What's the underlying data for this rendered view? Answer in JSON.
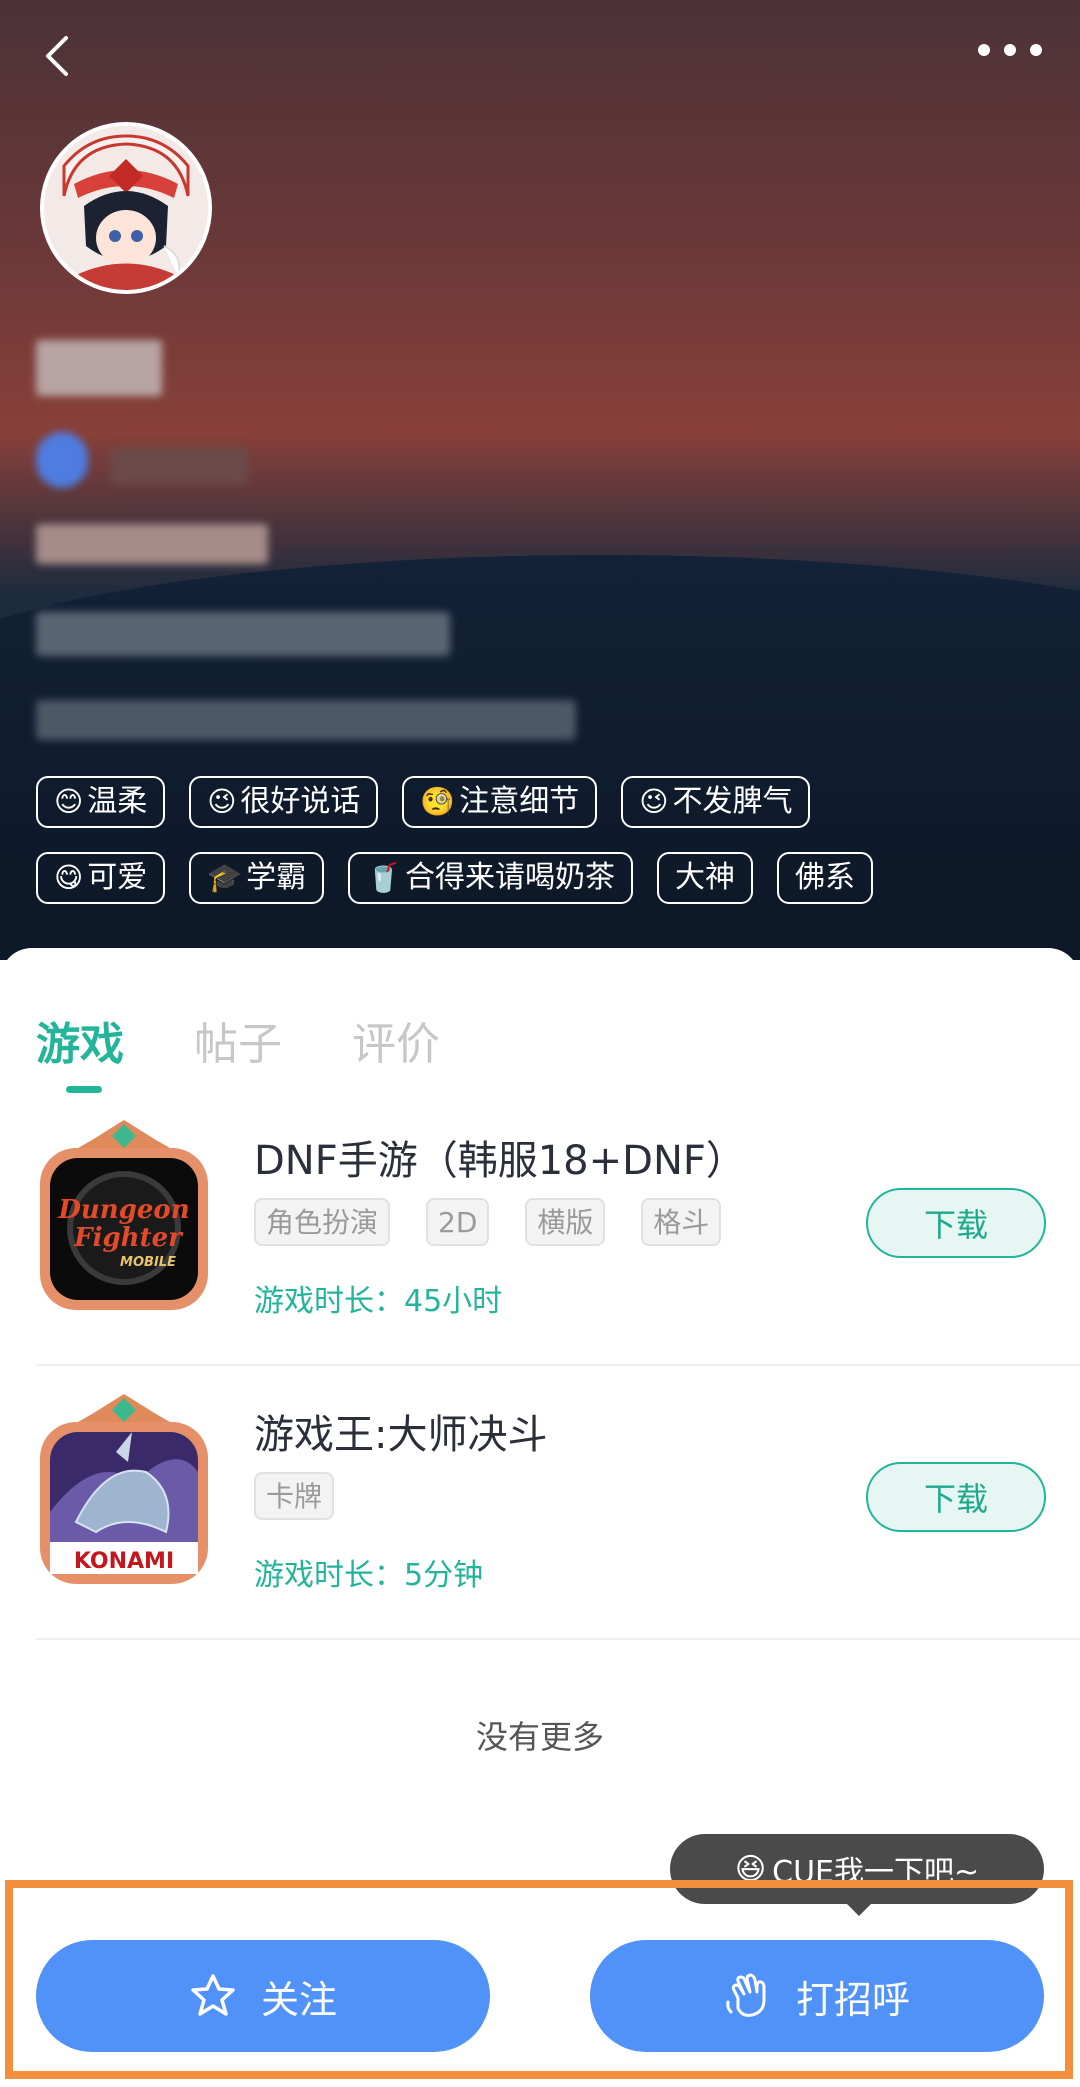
{
  "topbar": {
    "back_icon": "chevron-left-icon",
    "more_icon": "more-dots-icon"
  },
  "profile": {
    "tags_row1": [
      {
        "emoji": "😊",
        "label": "温柔"
      },
      {
        "emoji": "😉",
        "label": "很好说话"
      },
      {
        "emoji": "🧐",
        "label": "注意细节"
      },
      {
        "emoji": "😉",
        "label": "不发脾气"
      }
    ],
    "tags_row2": [
      {
        "emoji": "😋",
        "label": "可爱"
      },
      {
        "emoji": "🎓",
        "label": "学霸"
      },
      {
        "emoji": "🥤",
        "label": "合得来请喝奶茶"
      },
      {
        "emoji": "",
        "label": "大神"
      },
      {
        "emoji": "",
        "label": "佛系"
      }
    ]
  },
  "tabs": [
    {
      "label": "游戏",
      "active": true
    },
    {
      "label": "帖子",
      "active": false
    },
    {
      "label": "评价",
      "active": false
    }
  ],
  "games": [
    {
      "title": "DNF手游（韩服18+DNF）",
      "tags": [
        "角色扮演",
        "2D",
        "横版",
        "格斗"
      ],
      "playtime_label": "游戏时长：",
      "playtime": "45小时",
      "download_label": "下载",
      "icon_text_1": "Dungeon",
      "icon_text_2": "Fighter",
      "icon_text_3": "MOBILE"
    },
    {
      "title": "游戏王:大师决斗",
      "tags": [
        "卡牌"
      ],
      "playtime_label": "游戏时长：",
      "playtime": "5分钟",
      "download_label": "下载",
      "icon_text_1": "KONAMI"
    }
  ],
  "no_more": "没有更多",
  "tooltip": {
    "emoji": "😆",
    "text": "CUE我一下吧~"
  },
  "bottom": {
    "follow_label": "关注",
    "follow_icon": "star-icon",
    "greet_label": "打招呼",
    "greet_icon": "wave-hand-icon"
  },
  "colors": {
    "accent": "#22b59a",
    "primary_button": "#5092f8",
    "highlight": "#f38f3c"
  }
}
